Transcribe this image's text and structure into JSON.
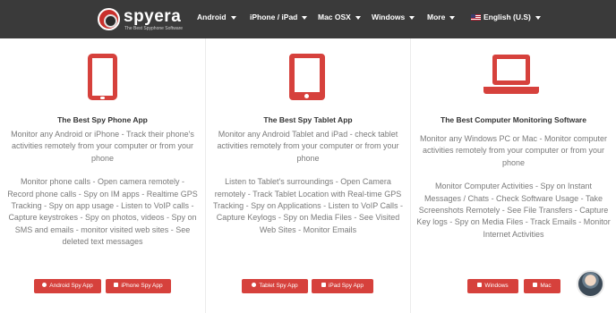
{
  "navbar": {
    "logo_text": "spyera",
    "logo_tagline": "The Best Spyphone Software",
    "menu": [
      {
        "label": "Android"
      },
      {
        "label": "iPhone / iPad"
      },
      {
        "label": "Mac OSX"
      },
      {
        "label": "Windows"
      },
      {
        "label": "More"
      },
      {
        "label": "English (U.S)"
      }
    ]
  },
  "columns": [
    {
      "icon": "phone-icon",
      "title": "The Best Spy Phone App",
      "intro": "Monitor any Android or iPhone - Track their phone's activities remotely from your computer or from your phone",
      "details": "Monitor phone calls - Open camera remotely - Record phone calls - Spy on IM apps - Realtime GPS Tracking - Spy on app usage - Listen to VoIP calls - Capture keystrokes - Spy on photos, videos - Spy on SMS and emails - monitor visited web sites - See deleted text messages",
      "buttons": [
        {
          "label": "Android Spy App"
        },
        {
          "label": "iPhone Spy App"
        }
      ]
    },
    {
      "icon": "tablet-icon",
      "title": "The Best Spy Tablet App",
      "intro": "Monitor any Android Tablet and iPad - check tablet activities remotely from your computer or from your phone",
      "details": "Listen to Tablet's surroundings - Open Camera remotely - Track Tablet Location with Real-time GPS Tracking - Spy on Applications - Listen to VoIP Calls - Capture Keylogs - Spy on Media Files - See Visited Web Sites - Monitor Emails",
      "buttons": [
        {
          "label": "Tablet Spy App"
        },
        {
          "label": "iPad Spy App"
        }
      ]
    },
    {
      "icon": "laptop-icon",
      "title": "The Best Computer Monitoring Software",
      "intro": "Monitor any Windows PC or Mac - Monitor computer activities remotely from your computer or from your phone",
      "details": "Monitor Computer Activities - Spy on Instant Messages / Chats - Check Software Usage - Take Screenshots Remotely - See File Transfers - Capture Key logs - Spy on Media Files - Track Emails - Monitor Internet Activities",
      "buttons": [
        {
          "label": "Windows"
        },
        {
          "label": "Mac"
        }
      ]
    }
  ],
  "colors": {
    "accent": "#d6413c",
    "navbar": "#3a3a3a"
  }
}
